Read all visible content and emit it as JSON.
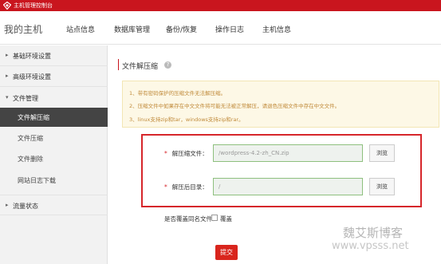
{
  "titlebar": {
    "title": "主机管理控制台"
  },
  "header": {
    "brand": "我的主机",
    "nav": [
      "站点信息",
      "数据库管理",
      "备份/恢复",
      "操作日志",
      "主机信息"
    ]
  },
  "sidebar": {
    "groups": [
      {
        "label": "基础环境设置",
        "caret": "▸"
      },
      {
        "label": "高级环境设置",
        "caret": "▸"
      },
      {
        "label": "文件管理",
        "caret": "▾"
      },
      {
        "label": "流量状态",
        "caret": "▸"
      }
    ],
    "file_items": [
      "文件解压缩",
      "文件压缩",
      "文件删除",
      "网站日志下载"
    ],
    "active_item": "文件解压缩"
  },
  "main": {
    "section_title": "文件解压缩",
    "help_icon": "?",
    "tips": [
      "1、带有密码保护的压缩文件无法解压缩。",
      "2、压缩文件中如果存在中文文件将可能无法被正常解压，请退色压缩文件中存在中文文件。",
      "3、linux支持zip和tar，windows支持zip和rar。"
    ],
    "archive_label": "解压缩文件：",
    "archive_value": "/wordpress-4.2-zh_CN.zip",
    "target_label": "解压后目录：",
    "target_value": "/",
    "required_mark": "*",
    "browse_label": "浏览",
    "overwrite_label": "是否覆盖同名文件：",
    "overwrite_option": "覆盖",
    "submit_label": "提交"
  },
  "watermark": {
    "name": "魏艾斯博客",
    "url": "www.vpsss.net"
  },
  "colors": {
    "brand_red": "#c9151e",
    "notice_bg": "#fdf8e6",
    "notice_text": "#c08a3a",
    "highlight_border": "#d6262b"
  }
}
